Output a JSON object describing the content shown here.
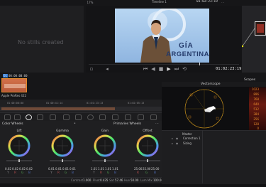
{
  "app": {
    "brand_color": "#e58b2c",
    "accent_blue": "#2f7bd8"
  },
  "gallery": {
    "empty_text": "No stills created"
  },
  "viewer": {
    "clip_name": "Timeline 1",
    "header_timecode": "01:02:23:19",
    "zoom": "17%",
    "timecode": "01:02:23:19",
    "frame_text_line1": "GÍA",
    "frame_text_line2": "ARGENTINA"
  },
  "clip": {
    "index": "01",
    "timecode": "00:00:00:00",
    "codec": "Apple ProRes 422"
  },
  "timeline": {
    "ticks": [
      "01:00:00:00",
      "01:00:41:14",
      "01:01:23:13",
      "01:02:05:13"
    ]
  },
  "color_wheels": {
    "title": "Color Wheels",
    "primaries_title": "Primaries Wheels",
    "wheels": [
      {
        "label": "Lift",
        "values": [
          "0.02",
          "0.02",
          "0.02",
          "0.02"
        ],
        "sub": [
          "Y",
          "R",
          "G",
          "B"
        ]
      },
      {
        "label": "Gamma",
        "values": [
          "0.01",
          "0.01",
          "0.01",
          "0.01"
        ],
        "sub": [
          "Y",
          "R",
          "G",
          "B"
        ]
      },
      {
        "label": "Gain",
        "values": [
          "1.01",
          "1.01",
          "1.01",
          "1.01"
        ],
        "sub": [
          "Y",
          "R",
          "G",
          "B"
        ]
      },
      {
        "label": "Offset",
        "values": [
          "25.00",
          "25.00",
          "25.00"
        ],
        "sub": [
          "R",
          "G",
          "B"
        ]
      }
    ],
    "footer": [
      {
        "label": "Contrast",
        "value": "1.000"
      },
      {
        "label": "Pivot",
        "value": "0.435"
      },
      {
        "label": "Sat",
        "value": "57.46"
      },
      {
        "label": "Hue",
        "value": "50.00"
      },
      {
        "label": "Lum Mix",
        "value": "100.00"
      }
    ]
  },
  "scopes": {
    "title": "Scopes",
    "mode": "Vectorscope",
    "scale_labels": [
      "1023",
      "896",
      "768",
      "640",
      "512",
      "384",
      "256",
      "128",
      "0"
    ]
  },
  "nodes": {
    "header": "Master",
    "items": [
      {
        "label": "Correction 1"
      },
      {
        "label": "Sizing"
      }
    ]
  }
}
